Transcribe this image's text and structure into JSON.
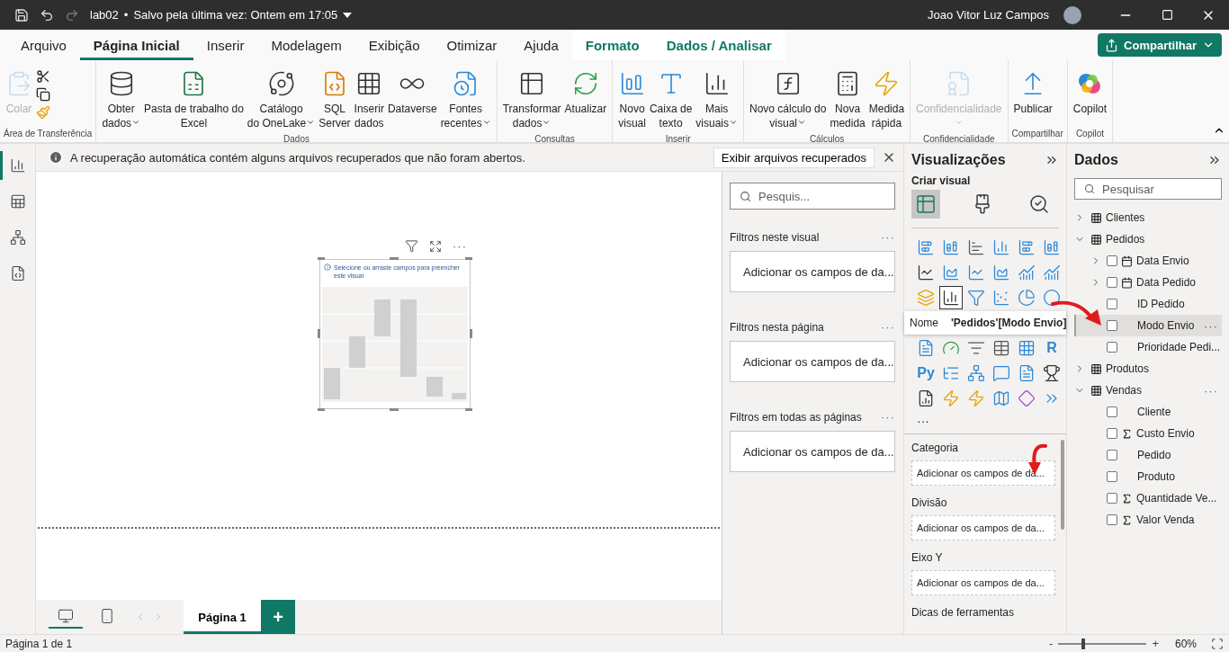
{
  "title_bar": {
    "file_name": "lab02",
    "separator": "•",
    "save_status": "Salvo pela última vez: Ontem em 17:05",
    "user_name": "Joao Vitor Luz Campos"
  },
  "menu_tabs": [
    {
      "label": "Arquivo",
      "selected": false,
      "contextual": false
    },
    {
      "label": "Página Inicial",
      "selected": true,
      "contextual": false
    },
    {
      "label": "Inserir",
      "selected": false,
      "contextual": false
    },
    {
      "label": "Modelagem",
      "selected": false,
      "contextual": false
    },
    {
      "label": "Exibição",
      "selected": false,
      "contextual": false
    },
    {
      "label": "Otimizar",
      "selected": false,
      "contextual": false
    },
    {
      "label": "Ajuda",
      "selected": false,
      "contextual": false
    },
    {
      "label": "Formato",
      "selected": false,
      "contextual": true
    },
    {
      "label": "Dados / Analisar",
      "selected": false,
      "contextual": true
    }
  ],
  "share_button": {
    "label": "Compartilhar"
  },
  "ribbon_groups": [
    {
      "label": "Área de Transferência",
      "items": [
        {
          "kind": "large",
          "lines": [
            "Colar"
          ],
          "disabled": true,
          "dropdown": false
        },
        {
          "kind": "icon_stack"
        }
      ]
    },
    {
      "label": "Dados",
      "items": [
        {
          "kind": "large",
          "lines": [
            "Obter",
            "dados"
          ],
          "disabled": false,
          "dropdown": true
        },
        {
          "kind": "large",
          "lines": [
            "Pasta de trabalho do",
            "Excel"
          ],
          "disabled": false,
          "dropdown": false
        },
        {
          "kind": "large",
          "lines": [
            "Catálogo",
            "do OneLake"
          ],
          "disabled": false,
          "dropdown": true
        },
        {
          "kind": "large",
          "lines": [
            "SQL",
            "Server"
          ],
          "disabled": false,
          "dropdown": false
        },
        {
          "kind": "large",
          "lines": [
            "Inserir",
            "dados"
          ],
          "disabled": false,
          "dropdown": false
        },
        {
          "kind": "large",
          "lines": [
            "Dataverse"
          ],
          "disabled": false,
          "dropdown": false
        },
        {
          "kind": "large",
          "lines": [
            "Fontes",
            "recentes"
          ],
          "disabled": false,
          "dropdown": true
        }
      ]
    },
    {
      "label": "Consultas",
      "items": [
        {
          "kind": "large",
          "lines": [
            "Transformar",
            "dados"
          ],
          "disabled": false,
          "dropdown": true
        },
        {
          "kind": "large",
          "lines": [
            "Atualizar"
          ],
          "disabled": false,
          "dropdown": false
        }
      ]
    },
    {
      "label": "Inserir",
      "items": [
        {
          "kind": "large",
          "lines": [
            "Novo",
            "visual"
          ],
          "disabled": false,
          "dropdown": false
        },
        {
          "kind": "large",
          "lines": [
            "Caixa de",
            "texto"
          ],
          "disabled": false,
          "dropdown": false
        },
        {
          "kind": "large",
          "lines": [
            "Mais",
            "visuais"
          ],
          "disabled": false,
          "dropdown": true
        }
      ]
    },
    {
      "label": "Cálculos",
      "items": [
        {
          "kind": "large",
          "lines": [
            "Novo cálculo do",
            "visual"
          ],
          "disabled": false,
          "dropdown": true
        },
        {
          "kind": "large",
          "lines": [
            "Nova",
            "medida"
          ],
          "disabled": false,
          "dropdown": false
        },
        {
          "kind": "large",
          "lines": [
            "Medida",
            "rápida"
          ],
          "disabled": false,
          "dropdown": false
        }
      ]
    },
    {
      "label": "Confidencialidade",
      "items": [
        {
          "kind": "large",
          "lines": [
            "Confidencialidade"
          ],
          "disabled": true,
          "dropdown": true
        }
      ]
    },
    {
      "label": "Compartilhar",
      "items": [
        {
          "kind": "large",
          "lines": [
            "Publicar"
          ],
          "disabled": false,
          "dropdown": false
        }
      ]
    },
    {
      "label": "Copilot",
      "items": [
        {
          "kind": "large",
          "lines": [
            "Copilot"
          ],
          "disabled": false,
          "dropdown": false
        }
      ]
    }
  ],
  "info_bar": {
    "message": "A recuperação automática contém alguns arquivos recuperados que não foram abertos.",
    "action": "Exibir arquivos recuperados"
  },
  "view_switcher": [
    {
      "selected": true
    },
    {
      "selected": false
    },
    {
      "selected": false
    },
    {
      "selected": false
    }
  ],
  "visual": {
    "message": "Selecione ou arraste campos para preencher este visual",
    "menu": "···"
  },
  "page_navigation": {
    "layouts": [
      {
        "selected": true
      },
      {
        "selected": false
      }
    ],
    "pages": [
      {
        "label": "Página 1",
        "selected": true
      }
    ],
    "add_page": "+"
  },
  "filters": {
    "search": {
      "placeholder": "Pesquis..."
    },
    "sections": [
      {
        "title": "Filtros neste visual",
        "menu": "···",
        "hint": "Adicionar os campos de da..."
      },
      {
        "title": "Filtros nesta página",
        "menu": "···",
        "hint": "Adicionar os campos de da..."
      },
      {
        "title": "Filtros em todas as páginas",
        "menu": "···",
        "hint": "Adicionar os campos de da..."
      }
    ]
  },
  "visualizations": {
    "title": "Visualizações",
    "subtitle": "Criar visual",
    "modes": [
      {
        "selected": true
      },
      {
        "selected": false
      },
      {
        "selected": false
      }
    ],
    "gallery": [
      {
        "kind": "icon",
        "selected": false
      },
      {
        "kind": "icon",
        "selected": false
      },
      {
        "kind": "icon",
        "selected": false
      },
      {
        "kind": "icon",
        "selected": false
      },
      {
        "kind": "icon",
        "selected": false
      },
      {
        "kind": "icon",
        "selected": false
      },
      {
        "kind": "icon",
        "selected": false
      },
      {
        "kind": "icon",
        "selected": false
      },
      {
        "kind": "icon",
        "selected": false
      },
      {
        "kind": "icon",
        "selected": false
      },
      {
        "kind": "icon",
        "selected": false
      },
      {
        "kind": "icon",
        "selected": false
      },
      {
        "kind": "icon",
        "selected": false
      },
      {
        "kind": "icon",
        "selected": true
      },
      {
        "kind": "icon",
        "selected": false
      },
      {
        "kind": "icon",
        "selected": false
      },
      {
        "kind": "icon",
        "selected": false
      },
      {
        "kind": "icon",
        "selected": false
      },
      {
        "kind": "icon",
        "selected": false
      },
      {
        "kind": "icon",
        "selected": false
      },
      {
        "kind": "icon",
        "selected": false
      },
      {
        "kind": "icon",
        "selected": false
      },
      {
        "kind": "icon",
        "selected": false
      },
      {
        "kind": "glyph",
        "label": "R",
        "selected": false
      },
      {
        "kind": "glyph",
        "label": "Py",
        "selected": false
      },
      {
        "kind": "icon",
        "selected": false
      },
      {
        "kind": "icon",
        "selected": false
      },
      {
        "kind": "icon",
        "selected": false
      },
      {
        "kind": "icon",
        "selected": false
      },
      {
        "kind": "icon",
        "selected": false
      },
      {
        "kind": "icon",
        "selected": false
      },
      {
        "kind": "icon",
        "selected": false
      },
      {
        "kind": "icon",
        "selected": false
      },
      {
        "kind": "icon",
        "selected": false
      },
      {
        "kind": "icon",
        "selected": false
      },
      {
        "kind": "icon",
        "selected": false
      }
    ],
    "more": "···",
    "tooltip": {
      "label": "Nome",
      "value": "'Pedidos'[Modo Envio]"
    },
    "wells": [
      {
        "label": "Categoria",
        "hint": "Adicionar os campos de da..."
      },
      {
        "label": "Divisão",
        "hint": "Adicionar os campos de da..."
      },
      {
        "label": "Eixo Y",
        "hint": "Adicionar os campos de da..."
      }
    ],
    "next_well": "Dicas de ferramentas"
  },
  "data": {
    "title": "Dados",
    "search": {
      "placeholder": "Pesquisar"
    },
    "tables": [
      {
        "label": "Clientes",
        "expanded": false
      },
      {
        "label": "Pedidos",
        "expanded": true,
        "children": [
          {
            "label": "Data Envio",
            "kind": "date",
            "checked": false,
            "hovered": false,
            "expanded": false
          },
          {
            "label": "Data Pedido",
            "kind": "date",
            "checked": false,
            "hovered": false,
            "expanded": false
          },
          {
            "label": "ID Pedido",
            "kind": "text",
            "checked": false,
            "hovered": false
          },
          {
            "label": "Modo Envio",
            "kind": "text",
            "checked": false,
            "hovered": true,
            "more": "···"
          },
          {
            "label": "Prioridade Pedi...",
            "kind": "text",
            "checked": false,
            "hovered": false
          }
        ]
      },
      {
        "label": "Produtos",
        "expanded": false
      },
      {
        "label": "Vendas",
        "expanded": true,
        "more": "···",
        "children": [
          {
            "label": "Cliente",
            "kind": "text",
            "checked": false,
            "hovered": false
          },
          {
            "label": "Custo Envio",
            "kind": "sum",
            "checked": false,
            "hovered": false
          },
          {
            "label": "Pedido",
            "kind": "text",
            "checked": false,
            "hovered": false
          },
          {
            "label": "Produto",
            "kind": "text",
            "checked": false,
            "hovered": false
          },
          {
            "label": "Quantidade Ve...",
            "kind": "sum",
            "checked": false,
            "hovered": false
          },
          {
            "label": "Valor Venda",
            "kind": "sum",
            "checked": false,
            "hovered": false
          }
        ]
      }
    ]
  },
  "status_bar": {
    "page_indicator": "Página 1 de 1",
    "zoom_out": "-",
    "zoom_in": "+",
    "zoom": {
      "level": 0.28
    },
    "zoom_label": "60%"
  }
}
